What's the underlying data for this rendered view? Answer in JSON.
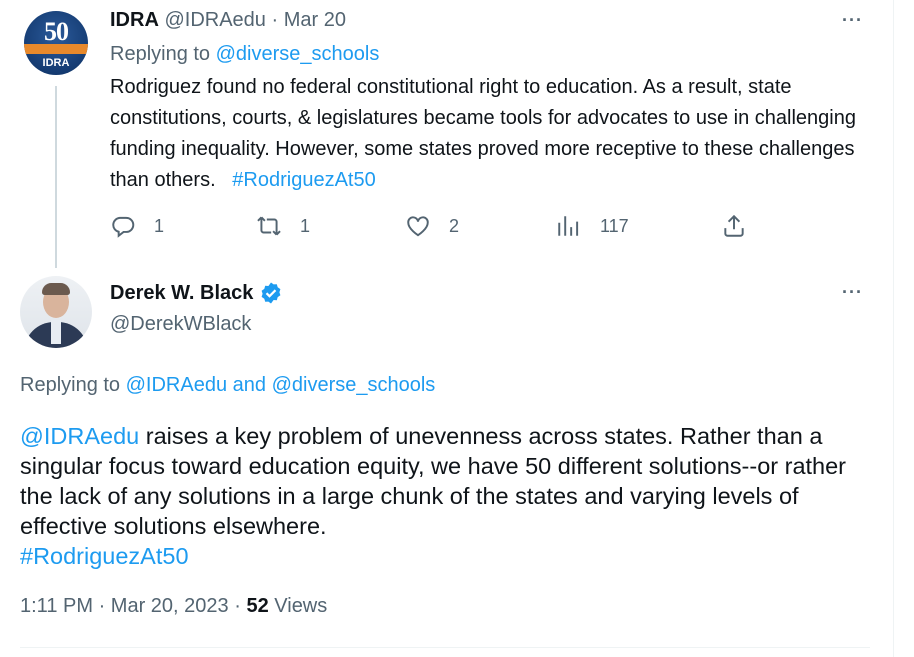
{
  "tweet1": {
    "display_name": "IDRA",
    "handle": "@IDRAedu",
    "separator": "·",
    "date": "Mar 20",
    "avatar": {
      "big_text": "50",
      "label": "IDRA",
      "ribbon_color": "#e8892b",
      "bg_color": "#153c73"
    },
    "replying_prefix": "Replying to",
    "replying_to": "@diverse_schools",
    "text": "Rodriguez found no federal constitutional right to education. As a result, state constitutions, courts, & legislatures became tools for advocates to use in challenging funding inequality. However, some states proved more receptive to these challenges than others.",
    "hashtag": "#RodriguezAt50",
    "more_icon": "···",
    "actions": {
      "reply": {
        "icon": "reply-icon",
        "count": "1"
      },
      "retweet": {
        "icon": "retweet-icon",
        "count": "1"
      },
      "like": {
        "icon": "heart-icon",
        "count": "2"
      },
      "views": {
        "icon": "views-icon",
        "count": "117"
      },
      "share": {
        "icon": "share-icon"
      }
    }
  },
  "tweet2": {
    "display_name": "Derek W. Black",
    "handle": "@DerekWBlack",
    "verified_icon": "verified-badge-icon",
    "more_icon": "···",
    "replying_prefix": "Replying to",
    "replying_to_1": "@IDRAedu",
    "replying_and": "and",
    "replying_to_2": "@diverse_schools",
    "mention": "@IDRAedu",
    "text": " raises a key problem of unevenness across states.  Rather than a singular focus toward education equity, we have 50 different solutions--or rather the lack of any solutions in a large chunk of the states and varying levels of effective solutions elsewhere.",
    "hashtag": "#RodriguezAt50",
    "time": "1:11 PM",
    "dot": "·",
    "date": "Mar 20, 2023",
    "views_count": "52",
    "views_label": "Views"
  },
  "colors": {
    "link": "#1d9bf0",
    "muted": "#536471",
    "text": "#0f1419",
    "verified": "#1d9bf0"
  }
}
